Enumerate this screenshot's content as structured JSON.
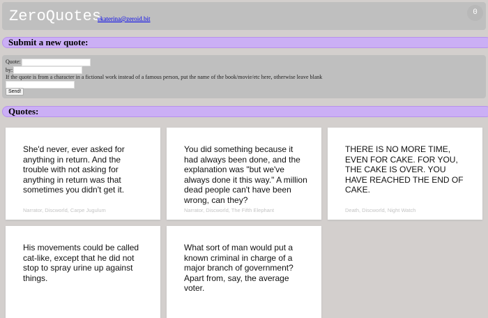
{
  "header": {
    "title": "ZeroQuotes",
    "email": "ekaterina@zeroid.bit",
    "count": "0"
  },
  "submit": {
    "heading": "Submit a new quote:",
    "quote_label": "Quote:",
    "by_label": "by:",
    "hint": "If the quote is from a character in a fictional work instead of a famous person, put the name of the book/movie/etc here, otherwise leave blank",
    "send_label": "Send!"
  },
  "quotes": {
    "heading": "Quotes:",
    "items": [
      {
        "text": "She'd never, ever asked for anything in return. And the trouble with not asking for anything in return was that sometimes you didn't get it.",
        "author": "Narrator, Discworld, Carpe Jugulum"
      },
      {
        "text": "You did something because it had always been done, and the explanation was \"but we've always done it this way.\" A million dead people can't have been wrong, can they?",
        "author": "Narrator, Discworld, The Fifth Elephant"
      },
      {
        "text": "THERE IS NO MORE TIME, EVEN FOR CAKE. FOR YOU, THE CAKE IS OVER. YOU HAVE REACHED THE END OF CAKE.",
        "author": "Death, Discworld, Night Watch"
      },
      {
        "text": "His movements could be called cat-like, except that he did not stop to spray urine up against things.",
        "author": ""
      },
      {
        "text": "What sort of man would put a known criminal in charge of a major branch of government? Apart from, say, the average voter.",
        "author": ""
      }
    ]
  }
}
